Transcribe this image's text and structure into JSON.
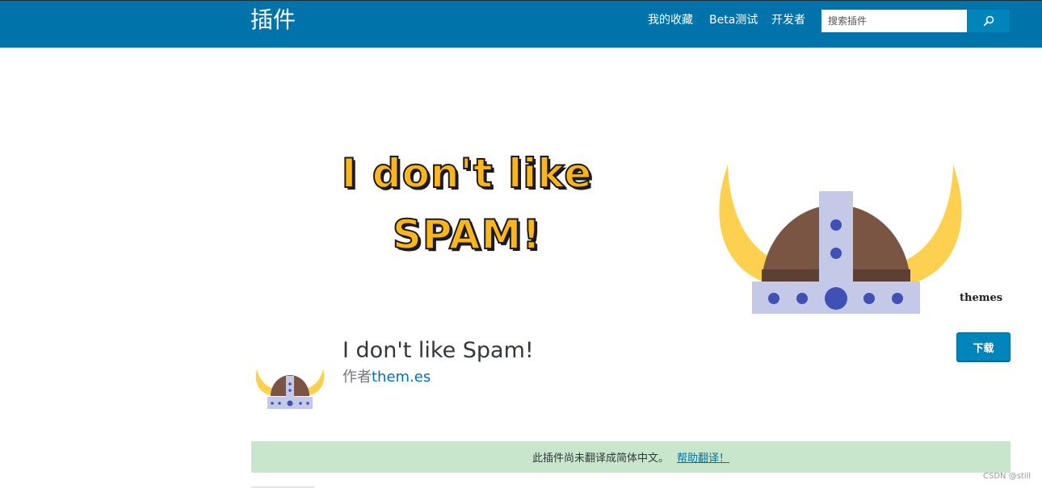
{
  "header": {
    "section_title": "插件",
    "nav": {
      "favorites": "我的收藏",
      "beta": "Beta测试",
      "developers": "开发者"
    },
    "search": {
      "placeholder": "搜索插件",
      "button_icon": "search-icon"
    }
  },
  "banner": {
    "line1": "I don't like",
    "line2": "SPAM!",
    "brand_mark": "themes",
    "colors": {
      "text": "#fbb61b",
      "horn": "#fdd14f",
      "dome": "#7a5544",
      "band": "#c5c9e8",
      "rivet": "#3f51b5"
    }
  },
  "plugin": {
    "title": "I don't like Spam!",
    "byline_prefix": "作者",
    "author": "them.es",
    "download_label": "下载"
  },
  "notice": {
    "text": "此插件尚未翻译成简体中文。",
    "link": "帮助翻译！"
  },
  "watermark": "CSDN @still",
  "colors": {
    "header_bg": "#0073aa",
    "accent": "#0085ba",
    "notice_bg": "#c8e6cb"
  }
}
